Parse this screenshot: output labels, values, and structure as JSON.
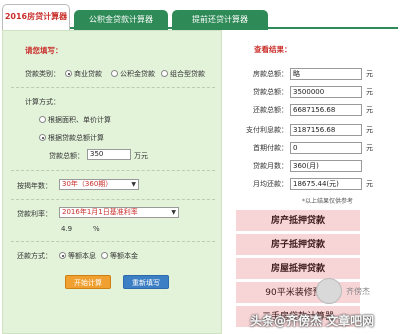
{
  "tabs": [
    {
      "label": "2016房贷计算器"
    },
    {
      "label": "公积金贷款计算器"
    },
    {
      "label": "提前还贷计算器"
    }
  ],
  "left": {
    "section_title": "请您填写：",
    "loan_type_label": "贷款类别：",
    "loan_types": [
      "商业贷款",
      "公积金贷款",
      "组合型贷款"
    ],
    "calc_method_label": "计算方式：",
    "calc_methods": [
      "根据面积、单价计算",
      "根据贷款总额计算"
    ],
    "loan_total_label": "贷款总额：",
    "loan_total_value": "350",
    "loan_total_unit": "万元",
    "years_label": "按揭年数：",
    "years_value": "30年（360期）",
    "rate_label": "贷款利率：",
    "rate_value": "2016年1月1日基准利率",
    "rate_number": "4.9",
    "rate_unit": "%",
    "repay_label": "还款方式：",
    "repay_methods": [
      "等额本息",
      "等额本金"
    ],
    "calc_button": "开始计算",
    "reset_button": "重新填写"
  },
  "right": {
    "section_title": "查看结果：",
    "rows": [
      {
        "label": "房款总额：",
        "value": "略",
        "unit": "元"
      },
      {
        "label": "贷款总额：",
        "value": "3500000",
        "unit": "元"
      },
      {
        "label": "还款总额：",
        "value": "6687156.68",
        "unit": "元"
      },
      {
        "label": "支付利息款：",
        "value": "3187156.68",
        "unit": "元"
      },
      {
        "label": "首期付款：",
        "value": "0",
        "unit": "元"
      },
      {
        "label": "贷款月数：",
        "value": "360(月)",
        "unit": ""
      },
      {
        "label": "月均还款：",
        "value": "18675.44(元)",
        "unit": "元"
      }
    ],
    "note": "*以上结果仅供参考",
    "promos": [
      "房产抵押贷款",
      "房子抵押贷款",
      "房屋抵押贷款",
      "90平米装修预算",
      "二手房贷款计算器"
    ]
  },
  "watermark": "头条@齐傍杰 文章吧网",
  "avatar_name": "齐傍杰"
}
